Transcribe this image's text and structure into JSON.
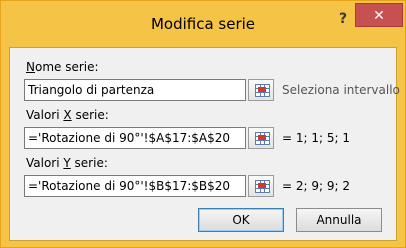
{
  "dialog": {
    "title": "Modifica serie",
    "help": "?",
    "close": "✕"
  },
  "fields": {
    "name": {
      "label_first": "N",
      "label_rest": "ome serie:",
      "value": "Triangolo di partenza",
      "side_text": "Seleziona intervallo"
    },
    "x_values": {
      "label_pre": "Valori ",
      "label_key": "X",
      "label_post": " serie:",
      "value": "='Rotazione di 90°'!$A$17:$A$20",
      "result": "= 1; 1; 5; 1"
    },
    "y_values": {
      "label_pre": "Valori ",
      "label_key": "Y",
      "label_post": " serie:",
      "value": "='Rotazione di 90°'!$B$17:$B$20",
      "result": "= 2; 9; 9; 2"
    }
  },
  "buttons": {
    "ok": "OK",
    "cancel": "Annulla"
  }
}
